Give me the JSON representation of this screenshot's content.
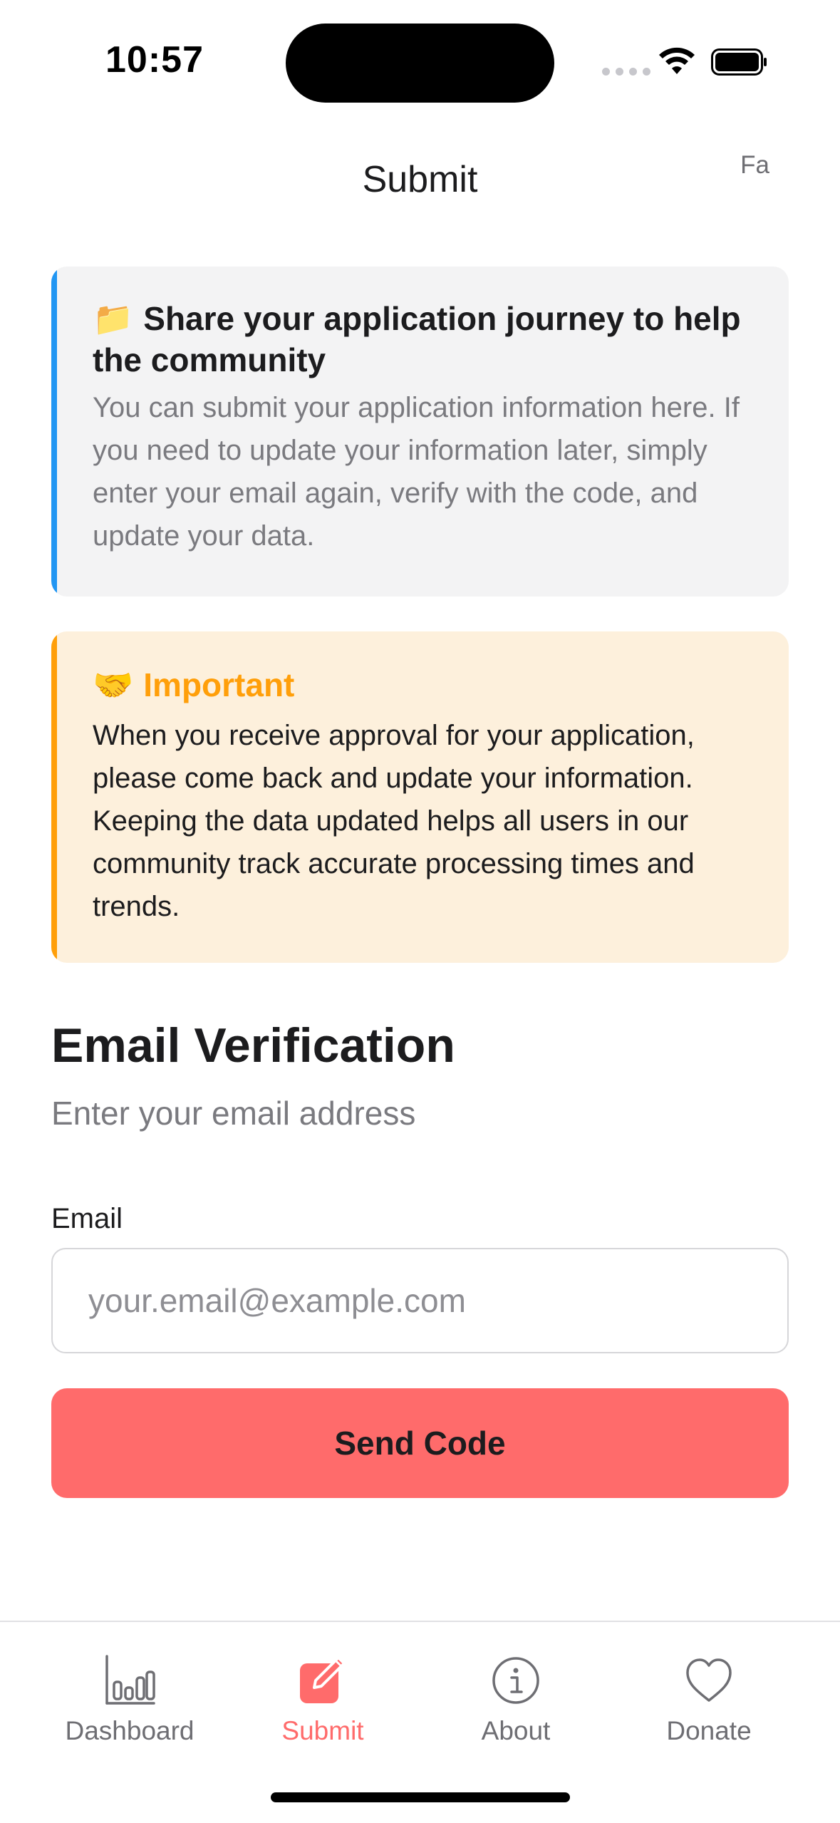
{
  "status_bar": {
    "time": "10:57"
  },
  "header": {
    "title": "Submit",
    "language_toggle": "Fa"
  },
  "info_card": {
    "icon": "folder-emoji",
    "icon_glyph": "📁",
    "title": "Share your application journey to help the community",
    "body": "You can submit your application information here. If you need to update your information later, simply enter your email again, verify with the code, and update your data.",
    "accent_color": "#2196f3"
  },
  "important_card": {
    "icon": "handshake-emoji",
    "icon_glyph": "🤝",
    "title": "Important",
    "body": "When you receive approval for your application, please come back and update your information. Keeping the data updated helps all users in our community track accurate processing times and trends.",
    "accent_color": "#ff9f0a"
  },
  "email_verification": {
    "title": "Email Verification",
    "subtitle": "Enter your email address",
    "email_label": "Email",
    "email_value": "",
    "email_placeholder": "your.email@example.com",
    "send_button": "Send Code",
    "button_color": "#ff6b6b"
  },
  "tab_bar": {
    "active_color": "#ff6b6b",
    "items": [
      {
        "label": "Dashboard",
        "icon": "bar-chart-icon",
        "active": false
      },
      {
        "label": "Submit",
        "icon": "edit-icon",
        "active": true
      },
      {
        "label": "About",
        "icon": "info-icon",
        "active": false
      },
      {
        "label": "Donate",
        "icon": "heart-icon",
        "active": false
      }
    ]
  }
}
